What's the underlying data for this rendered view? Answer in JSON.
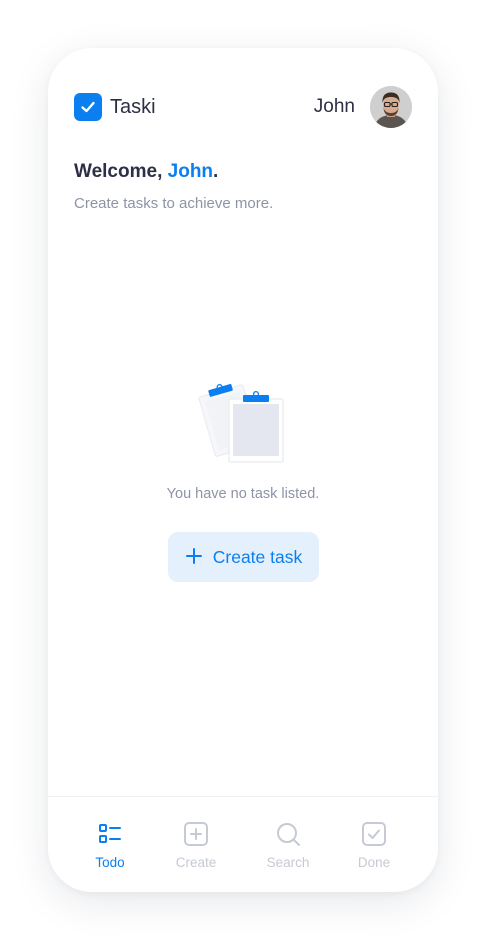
{
  "header": {
    "app_name": "Taski",
    "user_name": "John"
  },
  "welcome": {
    "greeting": "Welcome, ",
    "name": "John",
    "suffix": ".",
    "subtitle": "Create tasks to achieve more."
  },
  "empty_state": {
    "message": "You have no task listed.",
    "button_label": "Create task"
  },
  "bottom_nav": {
    "items": [
      {
        "label": "Todo",
        "icon": "list-icon",
        "active": true
      },
      {
        "label": "Create",
        "icon": "plus-square-icon",
        "active": false
      },
      {
        "label": "Search",
        "icon": "search-icon",
        "active": false
      },
      {
        "label": "Done",
        "icon": "check-square-icon",
        "active": false
      }
    ]
  },
  "colors": {
    "accent": "#0b7ff0",
    "text_dark": "#2c2f45",
    "text_muted": "#8e93a6",
    "nav_inactive": "#c6cad4",
    "button_bg": "#e4f0fc"
  }
}
